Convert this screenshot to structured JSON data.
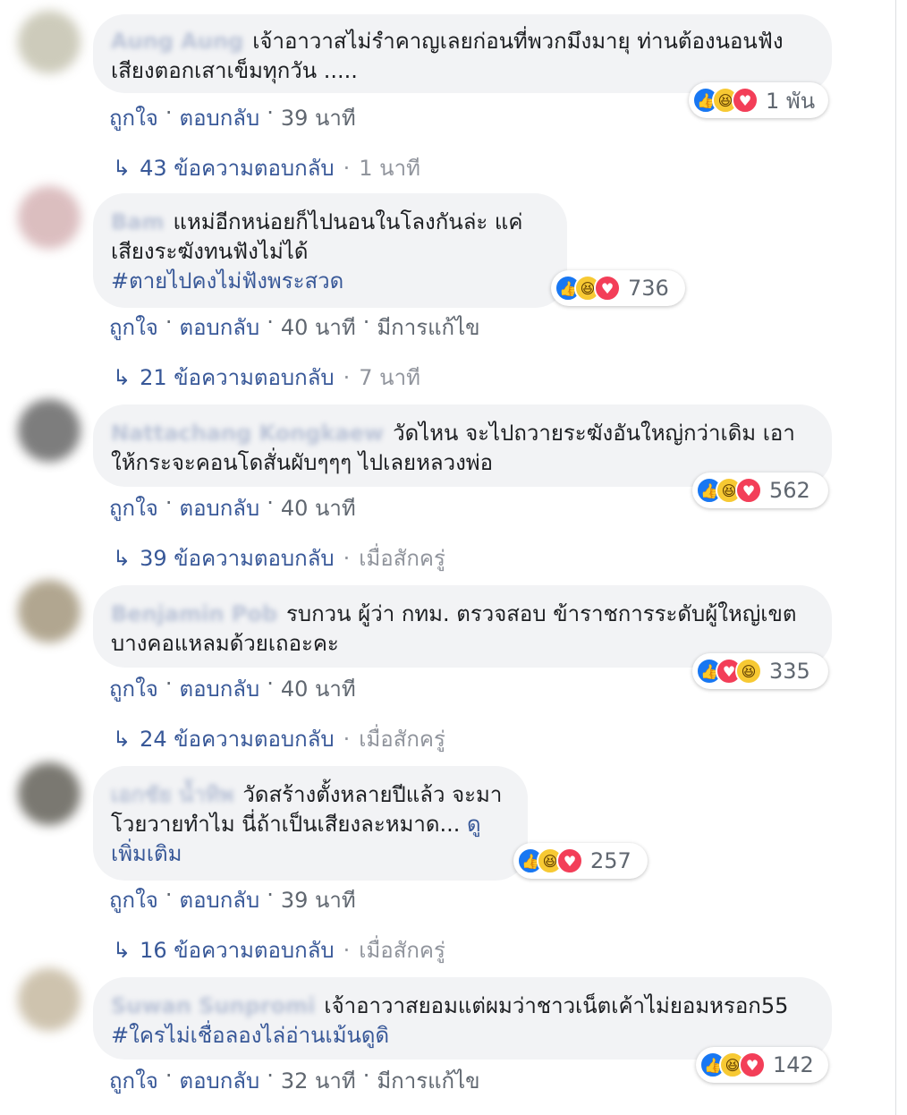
{
  "comments": [
    {
      "author": "Aung Aung",
      "text": "เจ้าอาวาสไม่รำคาญเลยก่อนที่พวกมึงมายุ ท่านต้องนอนฟังเสียงตอกเสาเข็มทุกวัน .....",
      "hashtag": "",
      "reaction_count": "1 พัน",
      "reactions": [
        "like-icon",
        "haha-icon",
        "love-icon"
      ],
      "like": "ถูกใจ",
      "reply": "ตอบกลับ",
      "time": "39 นาที",
      "edited": "",
      "replies_count": "43 ข้อความตอบกลับ",
      "replies_time": "1 นาที"
    },
    {
      "author": "Bam",
      "text": "แหม่อีกหน่อยก็ไปนอนในโลงกันล่ะ แค่เสียงระฆังทนฟังไม่ได้",
      "hashtag": "#ตายไปคงไม่ฟังพระสวด",
      "reaction_count": "736",
      "reactions": [
        "like-icon",
        "haha-icon",
        "love-icon"
      ],
      "like": "ถูกใจ",
      "reply": "ตอบกลับ",
      "time": "40 นาที",
      "edited": "มีการแก้ไข",
      "replies_count": "21 ข้อความตอบกลับ",
      "replies_time": "7 นาที"
    },
    {
      "author": "Nattachang Kongkaew",
      "text": "วัดไหน จะไปถวายระฆังอันใหญ่กว่าเดิม เอาให้กระจะคอนโดสั่นผับๆๆๆ ไปเลยหลวงพ่อ",
      "hashtag": "",
      "reaction_count": "562",
      "reactions": [
        "like-icon",
        "haha-icon",
        "love-icon"
      ],
      "like": "ถูกใจ",
      "reply": "ตอบกลับ",
      "time": "40 นาที",
      "edited": "",
      "replies_count": "39 ข้อความตอบกลับ",
      "replies_time": "เมื่อสักครู่"
    },
    {
      "author": "Benjamin Pob",
      "text": "รบกวน ผู้ว่า กทม. ตรวจสอบ ข้าราชการระดับผู้ใหญ่เขตบางคอแหลมด้วยเถอะคะ",
      "hashtag": "",
      "reaction_count": "335",
      "reactions": [
        "like-icon",
        "love-icon",
        "haha-icon"
      ],
      "like": "ถูกใจ",
      "reply": "ตอบกลับ",
      "time": "40 นาที",
      "edited": "",
      "replies_count": "24 ข้อความตอบกลับ",
      "replies_time": "เมื่อสักครู่"
    },
    {
      "author": "เอกชัย น้ำทิพ",
      "text": "วัดสร้างตั้งหลายปีแล้ว จะมาโวยวายทำไม นี่ถ้าเป็นเสียงละหมาด...",
      "see_more": "ดูเพิ่มเติม",
      "hashtag": "",
      "reaction_count": "257",
      "reactions": [
        "like-icon",
        "haha-icon",
        "love-icon"
      ],
      "like": "ถูกใจ",
      "reply": "ตอบกลับ",
      "time": "39 นาที",
      "edited": "",
      "replies_count": "16 ข้อความตอบกลับ",
      "replies_time": "เมื่อสักครู่"
    },
    {
      "author": "Suwan Sunpromi",
      "text": "เจ้าอาวาสยอมแต่ผมว่าชาวเน็ตเค้าไม่ยอมหรอก55",
      "hashtag": "#ใครไม่เชื่อลองไล่อ่านเม้นดูดิ",
      "reaction_count": "142",
      "reactions": [
        "like-icon",
        "haha-icon",
        "love-icon"
      ],
      "like": "ถูกใจ",
      "reply": "ตอบกลับ",
      "time": "32 นาที",
      "edited": "มีการแก้ไข",
      "replies_count": "",
      "replies_time": ""
    }
  ],
  "separator": "·"
}
